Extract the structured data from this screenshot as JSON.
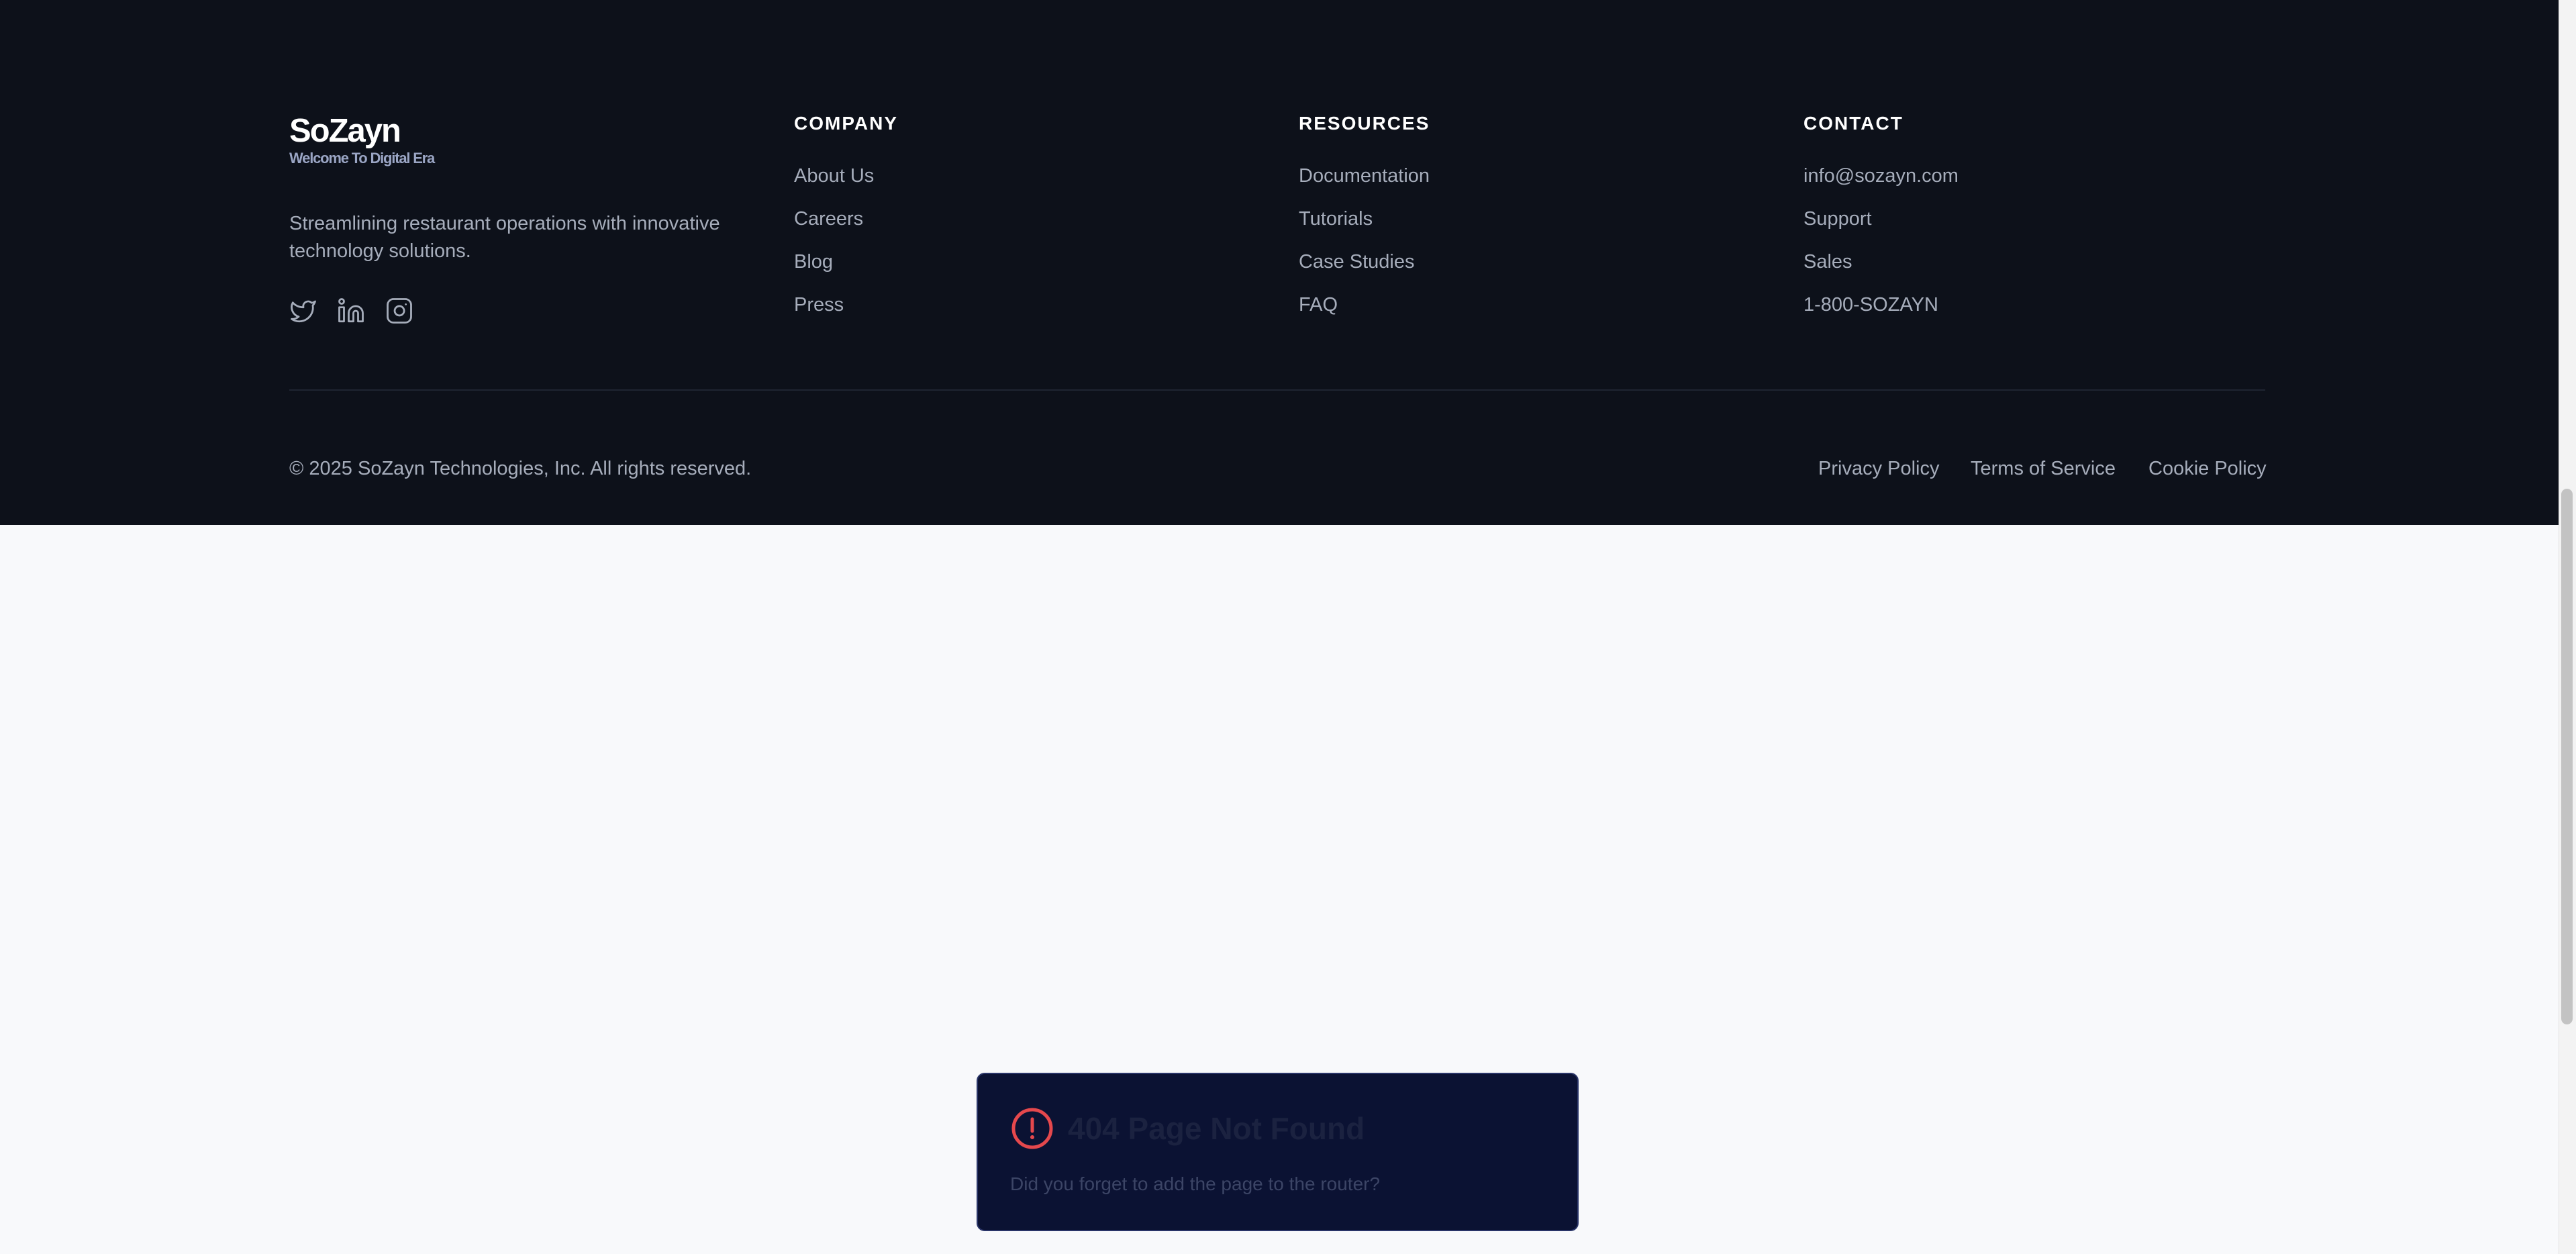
{
  "brand": {
    "name": "SoZayn",
    "tagline": "Welcome To Digital Era",
    "description": "Streamlining restaurant operations with innovative technology solutions.",
    "social_icons": [
      "twitter-icon",
      "linkedin-icon",
      "instagram-icon"
    ]
  },
  "company": {
    "heading": "COMPANY",
    "links": [
      "About Us",
      "Careers",
      "Blog",
      "Press"
    ]
  },
  "resources": {
    "heading": "RESOURCES",
    "links": [
      "Documentation",
      "Tutorials",
      "Case Studies",
      "FAQ"
    ]
  },
  "contact": {
    "heading": "CONTACT",
    "links": [
      "info@sozayn.com",
      "Support",
      "Sales",
      "1-800-SOZAYN"
    ]
  },
  "bottom": {
    "copyright": "© 2025 SoZayn Technologies, Inc. All rights reserved.",
    "legal_links": [
      "Privacy Policy",
      "Terms of Service",
      "Cookie Policy"
    ]
  },
  "toast": {
    "icon": "alert-circle-icon",
    "title": "404 Page Not Found",
    "message": "Did you forget to add the page to the router?"
  },
  "colors": {
    "footer_bg": "#0d111a",
    "page_bg": "#f8f9fb",
    "toast_bg": "#0b1233",
    "alert_red": "#e5484d"
  }
}
